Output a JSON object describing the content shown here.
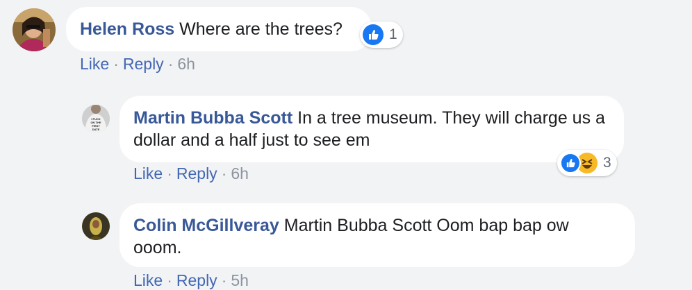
{
  "comments": [
    {
      "author": "Helen Ross",
      "text": "Where are the trees?",
      "actions": {
        "like": "Like",
        "reply": "Reply",
        "time": "6h"
      },
      "reactions": {
        "count": "1",
        "icons": [
          "like-icon"
        ]
      }
    },
    {
      "author": "Martin Bubba Scott",
      "text": "In a tree museum. They will charge us a dollar and a half just to see em",
      "avatar_shirt_text": "I FUCK ON THE FIRST DATE",
      "actions": {
        "like": "Like",
        "reply": "Reply",
        "time": "6h"
      },
      "reactions": {
        "count": "3",
        "icons": [
          "like-icon",
          "haha-icon"
        ]
      }
    },
    {
      "author": "Colin McGillveray",
      "text": "Martin Bubba Scott Oom bap bap ow ooom.",
      "actions": {
        "like": "Like",
        "reply": "Reply",
        "time": "5h"
      }
    }
  ],
  "colors": {
    "background": "#f2f3f5",
    "bubble": "#ffffff",
    "name": "#385898",
    "link": "#4267b2",
    "like_blue": "#1877f2",
    "haha_yellow": "#f7b928"
  }
}
